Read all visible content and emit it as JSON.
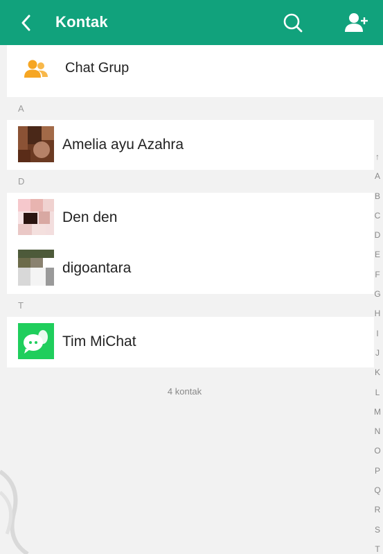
{
  "header": {
    "title": "Kontak",
    "back_icon": "back-chevron-icon",
    "search_icon": "search-icon",
    "add_icon": "add-contact-icon",
    "bg_color": "#11a27c"
  },
  "group": {
    "label": "Chat Grup",
    "icon": "group-icon",
    "icon_color": "#f6a623"
  },
  "sections": [
    {
      "letter": "A",
      "contacts": [
        {
          "name": "Amelia ayu Azahra"
        }
      ]
    },
    {
      "letter": "D",
      "contacts": [
        {
          "name": "Den den"
        },
        {
          "name": "digoantara"
        }
      ]
    },
    {
      "letter": "T",
      "contacts": [
        {
          "name": "Tim MiChat"
        }
      ]
    }
  ],
  "footer": {
    "count_label": "4 kontak"
  },
  "index": [
    "↑",
    "A",
    "B",
    "C",
    "D",
    "E",
    "F",
    "G",
    "H",
    "I",
    "J",
    "K",
    "L",
    "M",
    "N",
    "O",
    "P",
    "Q",
    "R",
    "S",
    "T"
  ]
}
